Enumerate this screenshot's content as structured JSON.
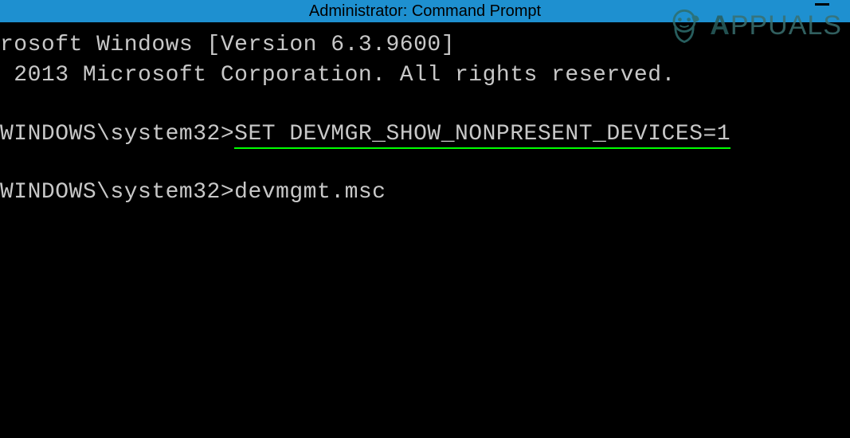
{
  "titlebar": {
    "title": "Administrator: Command Prompt"
  },
  "terminal": {
    "line1": "rosoft Windows [Version 6.3.9600]",
    "line2": " 2013 Microsoft Corporation. All rights reserved.",
    "prompt1_prefix": "WINDOWS\\system32>",
    "command1": "SET DEVMGR_SHOW_NONPRESENT_DEVICES=1",
    "prompt2_prefix": "WINDOWS\\system32>",
    "command2": "devmgmt.msc"
  },
  "watermark": {
    "brand_a": "A",
    "brand_rest": "PPUALS"
  }
}
